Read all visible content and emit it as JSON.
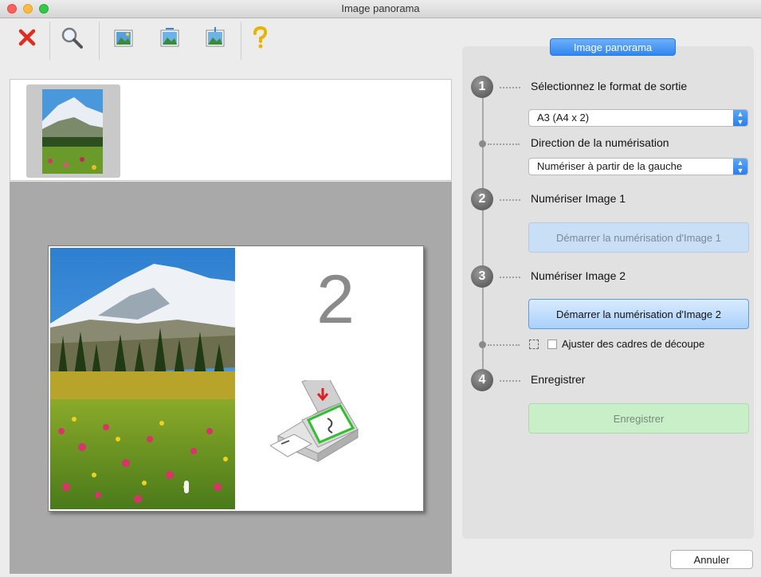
{
  "window": {
    "title": "Image panorama"
  },
  "toolbar": {
    "icons": [
      "close-icon",
      "zoom-icon",
      "image-icon",
      "image-icon",
      "image-icon",
      "help-icon"
    ]
  },
  "preview": {
    "number": "2"
  },
  "panel": {
    "tab_label": "Image panorama",
    "step1": {
      "number": "1",
      "label": "Sélectionnez le format de sortie",
      "format_value": "A3 (A4 x 2)",
      "direction_label": "Direction de la numérisation",
      "direction_value": "Numériser à partir de la gauche"
    },
    "step2": {
      "number": "2",
      "label": "Numériser Image 1",
      "button": "Démarrer la numérisation d'Image 1"
    },
    "step3": {
      "number": "3",
      "label": "Numériser Image 2",
      "button": "Démarrer la numérisation d'Image 2",
      "crop_label": "Ajuster des cadres de découpe"
    },
    "step4": {
      "number": "4",
      "label": "Enregistrer",
      "button": "Enregistrer"
    }
  },
  "footer": {
    "cancel": "Annuler"
  },
  "colors": {
    "accent": "#2f86f0",
    "save_button": "#c8efc8"
  }
}
